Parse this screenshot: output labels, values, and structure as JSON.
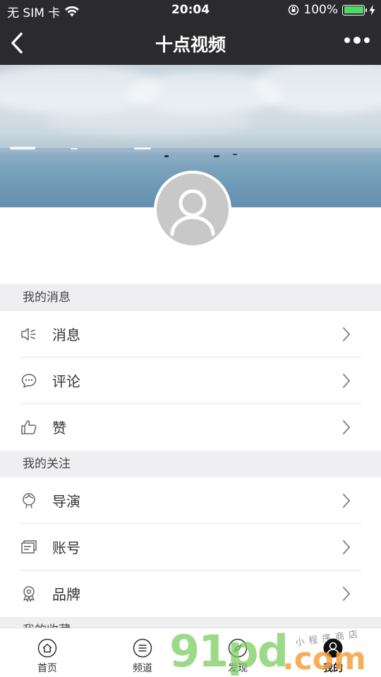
{
  "status_bar": {
    "carrier": "无 SIM 卡",
    "time": "20:04",
    "battery_text": "100%",
    "battery_level": 1.0,
    "battery_color": "#4cd964"
  },
  "nav": {
    "title": "十点视频",
    "back_icon": "chevron-left-icon",
    "more_icon": "more-dots-icon"
  },
  "sections": [
    {
      "title": "我的消息",
      "items": [
        {
          "label": "消息",
          "icon": "speaker-icon"
        },
        {
          "label": "评论",
          "icon": "comment-bubble-icon"
        },
        {
          "label": "赞",
          "icon": "thumbs-up-icon"
        }
      ]
    },
    {
      "title": "我的关注",
      "items": [
        {
          "label": "导演",
          "icon": "director-icon"
        },
        {
          "label": "账号",
          "icon": "account-card-icon"
        },
        {
          "label": "品牌",
          "icon": "brand-badge-icon"
        }
      ]
    },
    {
      "title": "我的收藏",
      "items": []
    }
  ],
  "tabs": [
    {
      "label": "首页",
      "icon": "home-icon",
      "active": false
    },
    {
      "label": "频道",
      "icon": "menu-circle-icon",
      "active": false
    },
    {
      "label": "发现",
      "icon": "compass-icon",
      "active": false
    },
    {
      "label": "我的",
      "icon": "user-icon",
      "active": true
    }
  ],
  "watermark": {
    "main": "91pd",
    "domain": ".com",
    "tagline": "小程序商店"
  }
}
